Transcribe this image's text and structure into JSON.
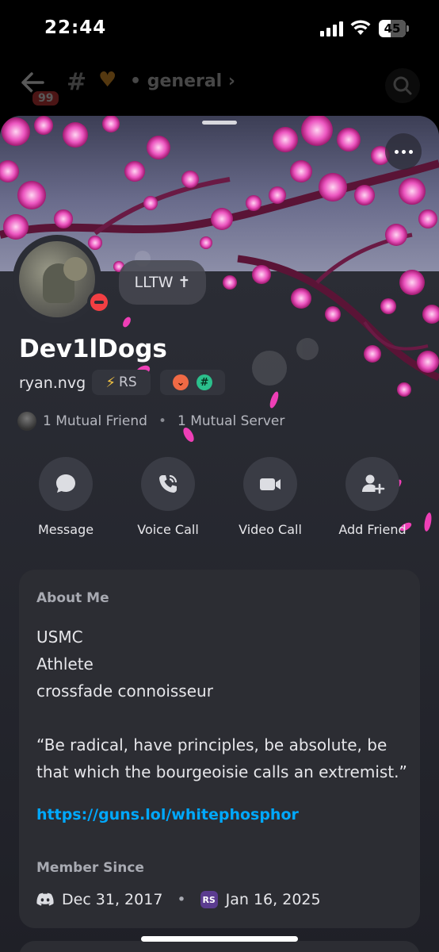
{
  "status_bar": {
    "time": "22:44",
    "battery": "45"
  },
  "channel_header": {
    "unread_count": "99",
    "channel_name": "general"
  },
  "profile": {
    "display_name": "Dev1lDogs",
    "username": "ryan.nvg",
    "tag": "RS",
    "custom_status": "LLTW ✝",
    "mutual_friends": "1 Mutual Friend",
    "mutual_servers": "1 Mutual Server"
  },
  "actions": [
    {
      "label": "Message",
      "icon": "message-icon"
    },
    {
      "label": "Voice Call",
      "icon": "phone-icon"
    },
    {
      "label": "Video Call",
      "icon": "video-icon"
    },
    {
      "label": "Add Friend",
      "icon": "add-friend-icon"
    }
  ],
  "about": {
    "heading": "About Me",
    "lines": [
      "USMC",
      "Athlete",
      "crossfade connoisseur",
      "",
      "“Be radical, have principles, be absolute, be",
      "that which the bourgeoisie calls an extremist.”"
    ],
    "link": "https://guns.lol/whitephosphor"
  },
  "member_since": {
    "heading": "Member Since",
    "discord_date": "Dec 31, 2017",
    "server_date": "Jan 16, 2025",
    "server_icon_text": "RS"
  },
  "colors": {
    "accent_link": "#00a8fc",
    "blossom": "#e73fb0",
    "dnd": "#f23f43"
  }
}
